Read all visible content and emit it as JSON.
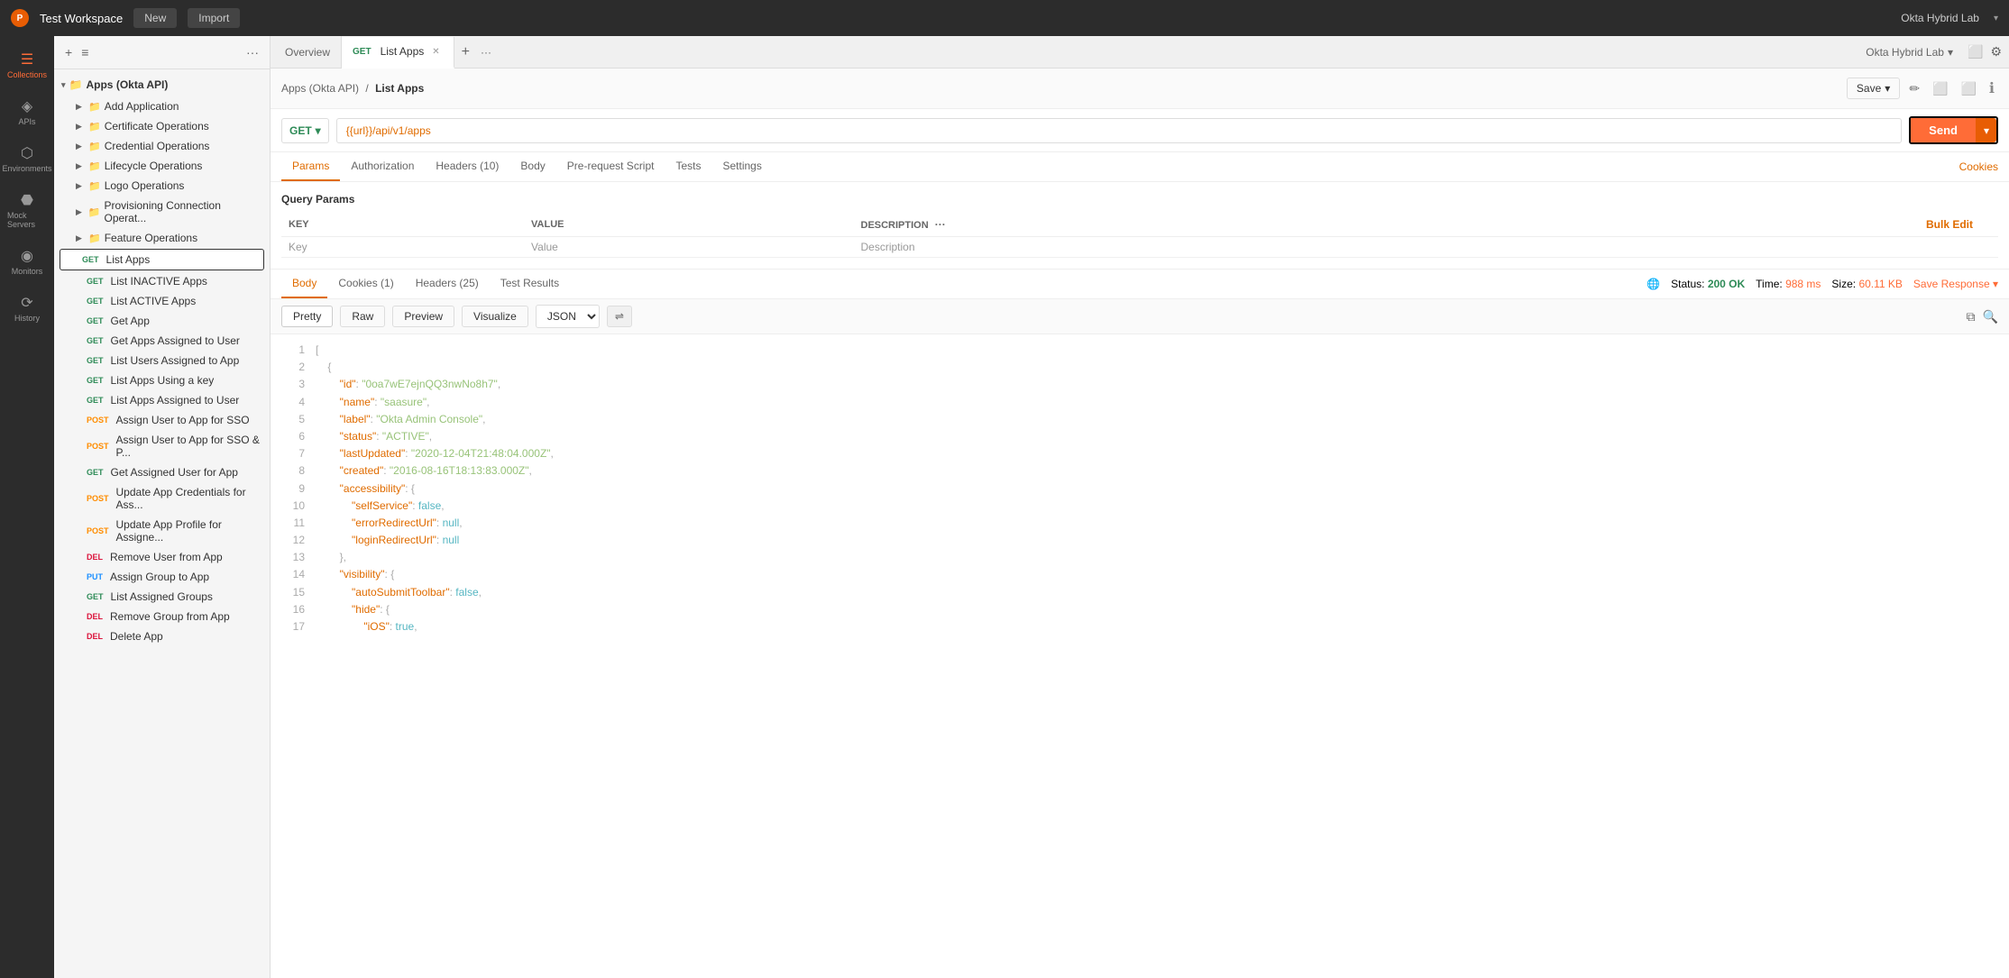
{
  "app": {
    "title": "Test Workspace",
    "logo": "P"
  },
  "header": {
    "new_label": "New",
    "import_label": "Import",
    "workspace_name": "Okta Hybrid Lab"
  },
  "sidebar": {
    "icons": [
      {
        "id": "collections",
        "label": "Collections",
        "symbol": "☰",
        "active": true
      },
      {
        "id": "apis",
        "label": "APIs",
        "symbol": "◈"
      },
      {
        "id": "environments",
        "label": "Environments",
        "symbol": "⬡"
      },
      {
        "id": "mock-servers",
        "label": "Mock Servers",
        "symbol": "⬣"
      },
      {
        "id": "monitors",
        "label": "Monitors",
        "symbol": "◉"
      },
      {
        "id": "history",
        "label": "History",
        "symbol": "⟳"
      }
    ]
  },
  "collections_panel": {
    "title": "Collections",
    "add_icon": "+",
    "menu_icon": "≡",
    "more_icon": "···",
    "collection": {
      "name": "Apps (Okta API)",
      "items": [
        {
          "label": "Add Application",
          "type": "folder",
          "indent": 1
        },
        {
          "label": "Certificate Operations",
          "type": "folder",
          "indent": 1
        },
        {
          "label": "Credential Operations",
          "type": "folder",
          "indent": 1
        },
        {
          "label": "Lifecycle Operations",
          "type": "folder",
          "indent": 1
        },
        {
          "label": "Logo Operations",
          "type": "folder",
          "indent": 1
        },
        {
          "label": "Provisioning Connection Operat...",
          "type": "folder",
          "indent": 1
        },
        {
          "label": "Feature Operations",
          "type": "folder",
          "indent": 1
        },
        {
          "label": "List Apps",
          "type": "request",
          "method": "GET",
          "active": true,
          "indent": 1
        },
        {
          "label": "List INACTIVE Apps",
          "type": "request",
          "method": "GET",
          "indent": 2
        },
        {
          "label": "List ACTIVE Apps",
          "type": "request",
          "method": "GET",
          "indent": 2
        },
        {
          "label": "Get App",
          "type": "request",
          "method": "GET",
          "indent": 2
        },
        {
          "label": "Get Apps Assigned to User",
          "type": "request",
          "method": "GET",
          "indent": 2
        },
        {
          "label": "List Users Assigned to App",
          "type": "request",
          "method": "GET",
          "indent": 2
        },
        {
          "label": "List Apps Using a key",
          "type": "request",
          "method": "GET",
          "indent": 2
        },
        {
          "label": "List Apps Assigned to User",
          "type": "request",
          "method": "GET",
          "indent": 2
        },
        {
          "label": "Assign User to App for SSO",
          "type": "request",
          "method": "POST",
          "indent": 2
        },
        {
          "label": "Assign User to App for SSO & P...",
          "type": "request",
          "method": "POST",
          "indent": 2
        },
        {
          "label": "Get Assigned User for App",
          "type": "request",
          "method": "GET",
          "indent": 2
        },
        {
          "label": "Update App Credentials for Ass...",
          "type": "request",
          "method": "POST",
          "indent": 2
        },
        {
          "label": "Update App Profile for Assigne...",
          "type": "request",
          "method": "POST",
          "indent": 2
        },
        {
          "label": "Remove User from App",
          "type": "request",
          "method": "DEL",
          "indent": 2
        },
        {
          "label": "Assign Group to App",
          "type": "request",
          "method": "PUT",
          "indent": 2
        },
        {
          "label": "List Assigned Groups",
          "type": "request",
          "method": "GET",
          "indent": 2
        },
        {
          "label": "Remove Group from App",
          "type": "request",
          "method": "DEL",
          "indent": 2
        },
        {
          "label": "Delete App",
          "type": "request",
          "method": "DEL",
          "indent": 2
        }
      ]
    }
  },
  "tabs": [
    {
      "label": "Overview",
      "active": false,
      "closable": false
    },
    {
      "label": "List Apps",
      "method": "GET",
      "active": true,
      "closable": true
    }
  ],
  "request": {
    "breadcrumb": {
      "parent": "Apps (Okta API)",
      "separator": "/",
      "current": "List Apps"
    },
    "method": "GET",
    "url": "{{url}}/api/v1/apps",
    "send_label": "Send",
    "save_label": "Save",
    "tabs": [
      {
        "label": "Params",
        "active": true
      },
      {
        "label": "Authorization"
      },
      {
        "label": "Headers (10)"
      },
      {
        "label": "Body"
      },
      {
        "label": "Pre-request Script"
      },
      {
        "label": "Tests"
      },
      {
        "label": "Settings"
      }
    ],
    "params": {
      "title": "Query Params",
      "columns": [
        "KEY",
        "VALUE",
        "DESCRIPTION"
      ],
      "placeholder_row": {
        "key": "Key",
        "value": "Value",
        "description": "Description"
      }
    }
  },
  "response": {
    "tabs": [
      {
        "label": "Body",
        "active": true
      },
      {
        "label": "Cookies (1)"
      },
      {
        "label": "Headers (25)"
      },
      {
        "label": "Test Results"
      }
    ],
    "status": "200 OK",
    "time": "988 ms",
    "size": "60.11 KB",
    "save_response": "Save Response",
    "formats": [
      "Pretty",
      "Raw",
      "Preview",
      "Visualize"
    ],
    "active_format": "Pretty",
    "content_type": "JSON",
    "code_lines": [
      {
        "num": 1,
        "content": "["
      },
      {
        "num": 2,
        "content": "    {"
      },
      {
        "num": 3,
        "content": "        \"id\": \"0oa7wE7ejnQQ3nwNo8h7\",",
        "type": "kv",
        "key": "id",
        "val": "0oa7wE7ejnQQ3nwNo8h7"
      },
      {
        "num": 4,
        "content": "        \"name\": \"saasure\",",
        "type": "kv",
        "key": "name",
        "val": "saasure"
      },
      {
        "num": 5,
        "content": "        \"label\": \"Okta Admin Console\",",
        "type": "kv",
        "key": "label",
        "val": "Okta Admin Console"
      },
      {
        "num": 6,
        "content": "        \"status\": \"ACTIVE\",",
        "type": "kv",
        "key": "status",
        "val": "ACTIVE"
      },
      {
        "num": 7,
        "content": "        \"lastUpdated\": \"2020-12-04T21:48:04.000Z\",",
        "type": "kv",
        "key": "lastUpdated",
        "val": "2020-12-04T21:48:04.000Z"
      },
      {
        "num": 8,
        "content": "        \"created\": \"2016-08-16T18:13:83.000Z\",",
        "type": "kv",
        "key": "created",
        "val": "2016-08-16T18:13:83.000Z"
      },
      {
        "num": 9,
        "content": "        \"accessibility\": {",
        "type": "kv_open",
        "key": "accessibility"
      },
      {
        "num": 10,
        "content": "            \"selfService\": false,",
        "type": "kv",
        "key": "selfService",
        "val": "false"
      },
      {
        "num": 11,
        "content": "            \"errorRedirectUrl\": null,",
        "type": "kv",
        "key": "errorRedirectUrl",
        "val": "null"
      },
      {
        "num": 12,
        "content": "            \"loginRedirectUrl\": null",
        "type": "kv",
        "key": "loginRedirectUrl",
        "val": "null"
      },
      {
        "num": 13,
        "content": "        },"
      },
      {
        "num": 14,
        "content": "        \"visibility\": {",
        "type": "kv_open",
        "key": "visibility"
      },
      {
        "num": 15,
        "content": "            \"autoSubmitToolbar\": false,",
        "type": "kv",
        "key": "autoSubmitToolbar",
        "val": "false"
      },
      {
        "num": 16,
        "content": "            \"hide\": {",
        "type": "kv_open",
        "key": "hide"
      },
      {
        "num": 17,
        "content": "                \"iOS\": true,",
        "type": "kv",
        "key": "iOS",
        "val": "true"
      }
    ]
  }
}
